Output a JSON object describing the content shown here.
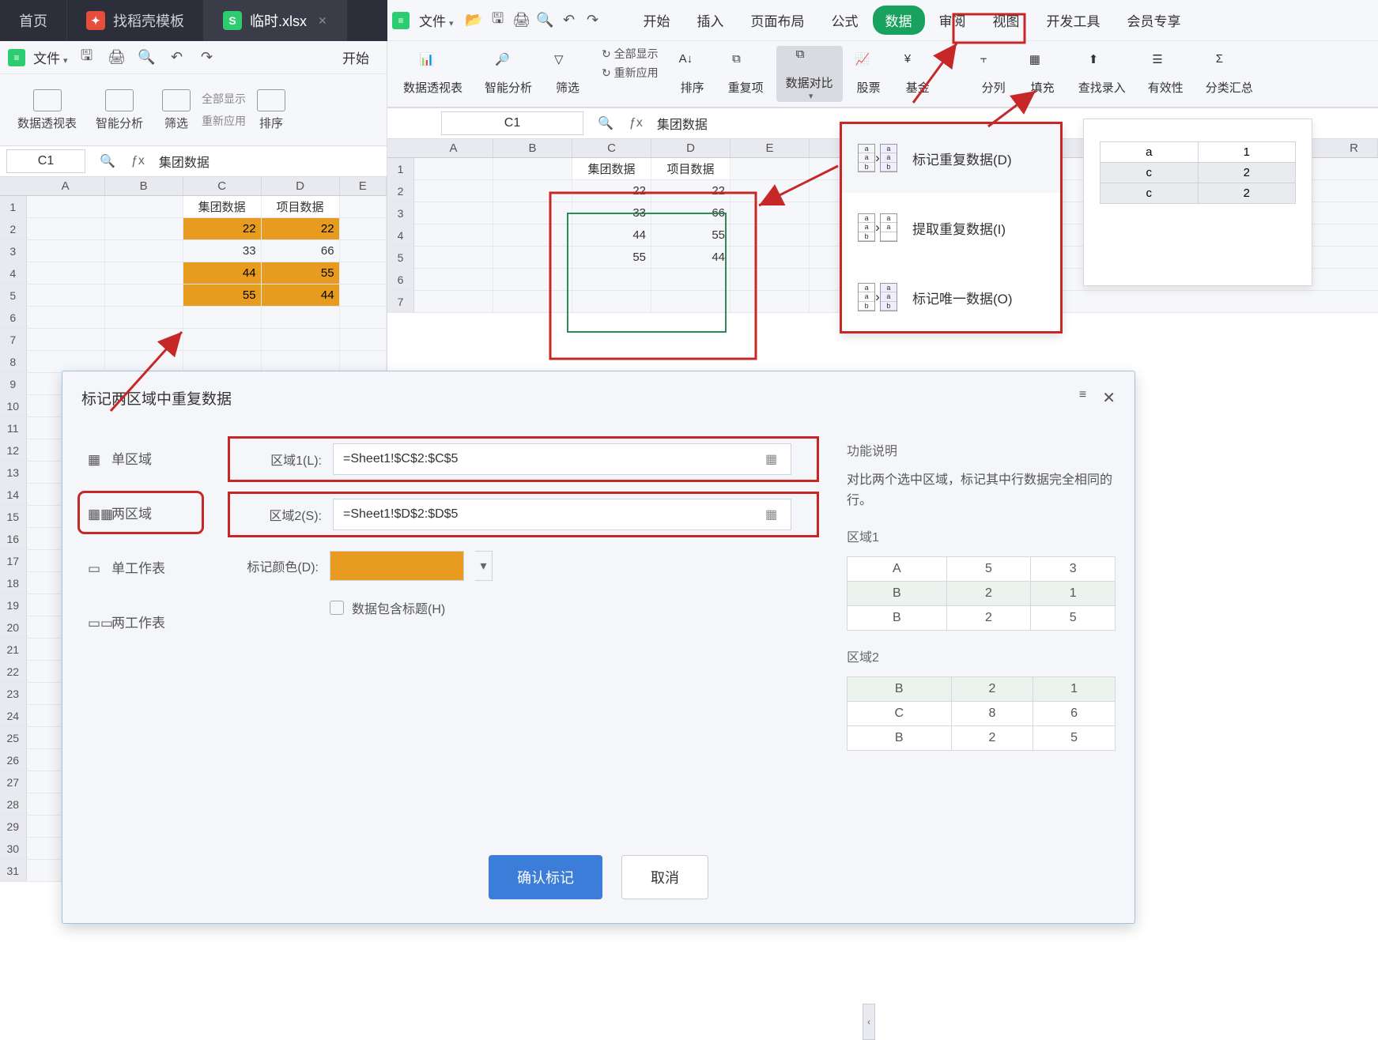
{
  "titlebar": {
    "tabs": [
      {
        "label": "首页"
      },
      {
        "label": "找稻壳模板"
      },
      {
        "label": "临时.xlsx"
      }
    ]
  },
  "left_window": {
    "file_menu": "文件",
    "start_tab": "开始",
    "ribbon": {
      "pivot": "数据透视表",
      "smart": "智能分析",
      "filter": "筛选",
      "show_all": "全部显示",
      "reapply": "重新应用",
      "sort": "排序"
    },
    "name_box": "C1",
    "formula_text": "集团数据",
    "columns": [
      "A",
      "B",
      "C",
      "D",
      "E"
    ],
    "headers": {
      "c": "集团数据",
      "d": "项目数据"
    },
    "rows": [
      {
        "c": "22",
        "d": "22",
        "hl": true
      },
      {
        "c": "33",
        "d": "66",
        "hl": false
      },
      {
        "c": "44",
        "d": "55",
        "hl": true
      },
      {
        "c": "55",
        "d": "44",
        "hl": true
      }
    ]
  },
  "right_window": {
    "file_menu": "文件",
    "menus": [
      "开始",
      "插入",
      "页面布局",
      "公式",
      "数据",
      "审阅",
      "视图",
      "开发工具",
      "会员专享"
    ],
    "active_menu_index": 4,
    "ribbon": {
      "pivot": "数据透视表",
      "smart": "智能分析",
      "filter": "筛选",
      "show_all": "全部显示",
      "reapply": "重新应用",
      "sort": "排序",
      "dup": "重复项",
      "compare": "数据对比",
      "stock": "股票",
      "fund": "基金",
      "split": "分列",
      "fill": "填充",
      "findrec": "查找录入",
      "validity": "有效性",
      "subtotal": "分类汇总"
    },
    "name_box": "C1",
    "formula_text": "集团数据",
    "columns": [
      "A",
      "B",
      "C",
      "D",
      "E"
    ],
    "far_col": "R",
    "headers": {
      "c": "集团数据",
      "d": "项目数据"
    },
    "rows": [
      {
        "c": "22",
        "d": "22"
      },
      {
        "c": "33",
        "d": "66"
      },
      {
        "c": "44",
        "d": "55"
      },
      {
        "c": "55",
        "d": "44"
      }
    ]
  },
  "dropdown": {
    "items": [
      {
        "label": "标记重复数据(D)"
      },
      {
        "label": "提取重复数据(I)"
      },
      {
        "label": "标记唯一数据(O)"
      }
    ]
  },
  "help_popup": {
    "rows": [
      [
        "a",
        "1"
      ],
      [
        "c",
        "2"
      ],
      [
        "c",
        "2"
      ]
    ]
  },
  "dialog": {
    "title": "标记两区域中重复数据",
    "sidebar": [
      "单区域",
      "两区域",
      "单工作表",
      "两工作表"
    ],
    "active_side_index": 1,
    "field1_label": "区域1(L):",
    "field1_value": "=Sheet1!$C$2:$C$5",
    "field2_label": "区域2(S):",
    "field2_value": "=Sheet1!$D$2:$D$5",
    "color_label": "标记颜色(D):",
    "color_value": "#e89c1f",
    "checkbox_label": "数据包含标题(H)",
    "help_heading": "功能说明",
    "help_text": "对比两个选中区域，标记其中行数据完全相同的行。",
    "region1_label": "区域1",
    "region1_rows": [
      [
        "A",
        "5",
        "3"
      ],
      [
        "B",
        "2",
        "1"
      ],
      [
        "B",
        "2",
        "5"
      ]
    ],
    "region1_match": [
      false,
      true,
      false
    ],
    "region2_label": "区域2",
    "region2_rows": [
      [
        "B",
        "2",
        "1"
      ],
      [
        "C",
        "8",
        "6"
      ],
      [
        "B",
        "2",
        "5"
      ]
    ],
    "region2_match": [
      true,
      false,
      false
    ],
    "confirm": "确认标记",
    "cancel": "取消"
  }
}
